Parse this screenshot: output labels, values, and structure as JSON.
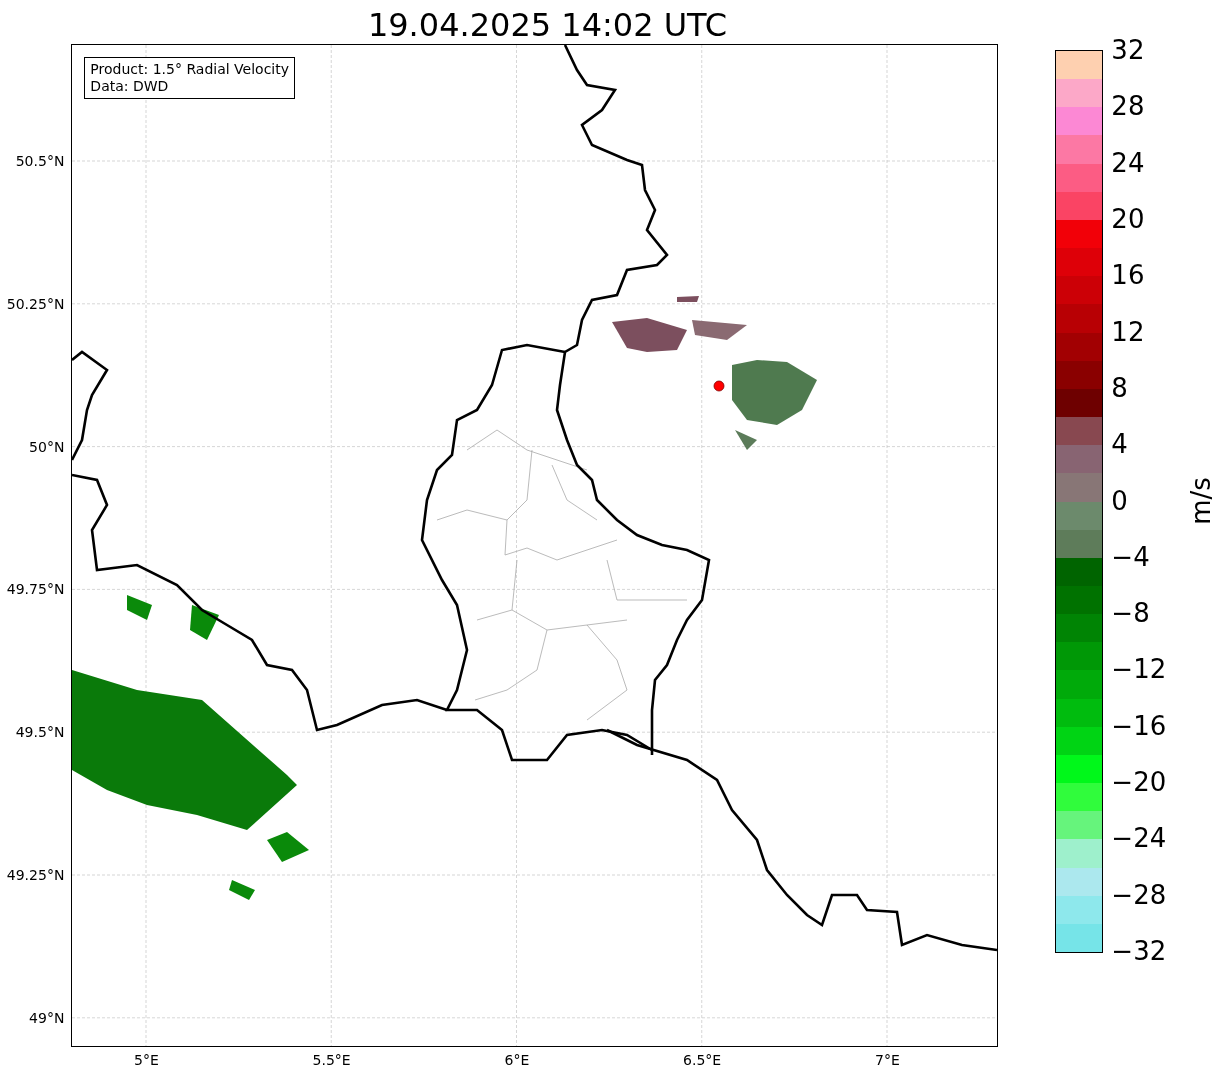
{
  "title": "19.04.2025 14:02 UTC",
  "info_box": [
    "Product: 1.5° Radial Velocity",
    "Data: DWD"
  ],
  "map": {
    "lat_ticks": [
      "50.5°N",
      "50.25°N",
      "50°N",
      "49.75°N",
      "49.5°N",
      "49.25°N",
      "49°N"
    ],
    "lon_ticks": [
      "5°E",
      "5.5°E",
      "6°E",
      "6.5°E",
      "7°E"
    ]
  },
  "colorbar": {
    "label": "m/s",
    "ticks": [
      "32",
      "28",
      "24",
      "20",
      "16",
      "12",
      "8",
      "4",
      "0",
      "−4",
      "−8",
      "−12",
      "−16",
      "−20",
      "−24",
      "−28",
      "−32"
    ],
    "bins": [
      {
        "color": "#fed0b0"
      },
      {
        "color": "#fca8c8"
      },
      {
        "color": "#fc88d4"
      },
      {
        "color": "#fc78a4"
      },
      {
        "color": "#fc5c84"
      },
      {
        "color": "#fa4464"
      },
      {
        "color": "#f20008"
      },
      {
        "color": "#de0008"
      },
      {
        "color": "#cc0006"
      },
      {
        "color": "#b80004"
      },
      {
        "color": "#a20002"
      },
      {
        "color": "#8a0000"
      },
      {
        "color": "#6e0000"
      },
      {
        "color": "#884850"
      },
      {
        "color": "#886472"
      },
      {
        "color": "#887676"
      },
      {
        "color": "#6c8a6c"
      },
      {
        "color": "#5e7c5a"
      },
      {
        "color": "#006400"
      },
      {
        "color": "#007200"
      },
      {
        "color": "#008404"
      },
      {
        "color": "#009806"
      },
      {
        "color": "#00aa0a"
      },
      {
        "color": "#00bc0e"
      },
      {
        "color": "#00d414"
      },
      {
        "color": "#00f81a"
      },
      {
        "color": "#30fc3c"
      },
      {
        "color": "#66f47c"
      },
      {
        "color": "#9ef0cc"
      },
      {
        "color": "#ace8ee"
      },
      {
        "color": "#8ee8ec"
      },
      {
        "color": "#76e4e8"
      }
    ]
  }
}
